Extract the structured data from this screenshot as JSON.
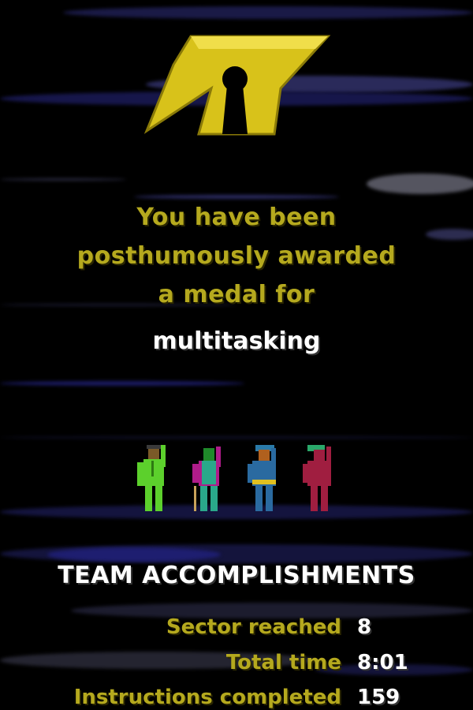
{
  "award": {
    "lines": [
      "You have been",
      "posthumously awarded",
      "a medal for"
    ],
    "reason": "multitasking"
  },
  "accomplishments": {
    "title": "TEAM ACCOMPLISHMENTS",
    "stats": [
      {
        "label": "Sector reached",
        "value": "8"
      },
      {
        "label": "Total time",
        "value": "8:01"
      },
      {
        "label": "Instructions completed",
        "value": "159"
      }
    ]
  },
  "icons": {
    "logo": "keyhole-emblem-icon",
    "crew": [
      "crew-member-green-icon",
      "crew-member-purple-icon",
      "crew-member-blue-icon",
      "crew-member-red-icon"
    ]
  },
  "colors": {
    "background": "#000000",
    "accent_yellow": "#b5a91e",
    "logo_gold": "#d8c21a",
    "text_white": "#ffffff"
  }
}
